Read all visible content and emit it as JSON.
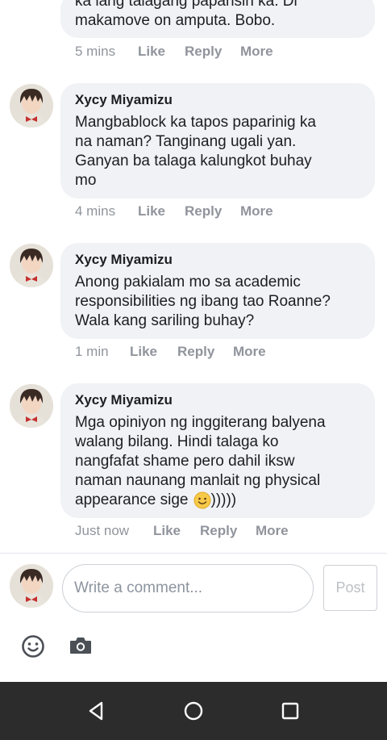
{
  "comments": [
    {
      "body": "ka lang talagang papansin ka. Di\nmakamove on amputa. Bobo.",
      "time": "5 mins",
      "like": "Like",
      "reply": "Reply",
      "more": "More"
    },
    {
      "author": "Xycy Miyamizu",
      "body": "Mangbablock ka tapos paparinig ka\nna naman? Tanginang ugali yan.\nGanyan ba talaga kalungkot buhay\nmo",
      "time": "4 mins",
      "like": "Like",
      "reply": "Reply",
      "more": "More"
    },
    {
      "author": "Xycy Miyamizu",
      "body": "Anong pakialam mo sa academic\nresponsibilities ng ibang tao Roanne?\nWala kang sariling buhay?",
      "time": "1 min",
      "like": "Like",
      "reply": "Reply",
      "more": "More"
    },
    {
      "author": "Xycy Miyamizu",
      "body_lines": [
        "Mga opiniyon ng inggiterang balyena",
        "walang bilang. Hindi talaga ko",
        "nangfafat shame pero dahil iksw",
        "naman naunang manlait ng physical"
      ],
      "body_last": "appearance sige",
      "body_suffix": ")))))",
      "time": "Just now",
      "like": "Like",
      "reply": "Reply",
      "more": "More"
    }
  ],
  "composer": {
    "placeholder": "Write a comment...",
    "post_label": "Post"
  },
  "icons": [
    "smiley-icon",
    "camera-icon",
    "back-icon",
    "home-icon",
    "recents-icon"
  ],
  "colors": {
    "bubble": "#f0f2f5",
    "meta": "#90949c",
    "navbar": "#2c2c2c"
  }
}
